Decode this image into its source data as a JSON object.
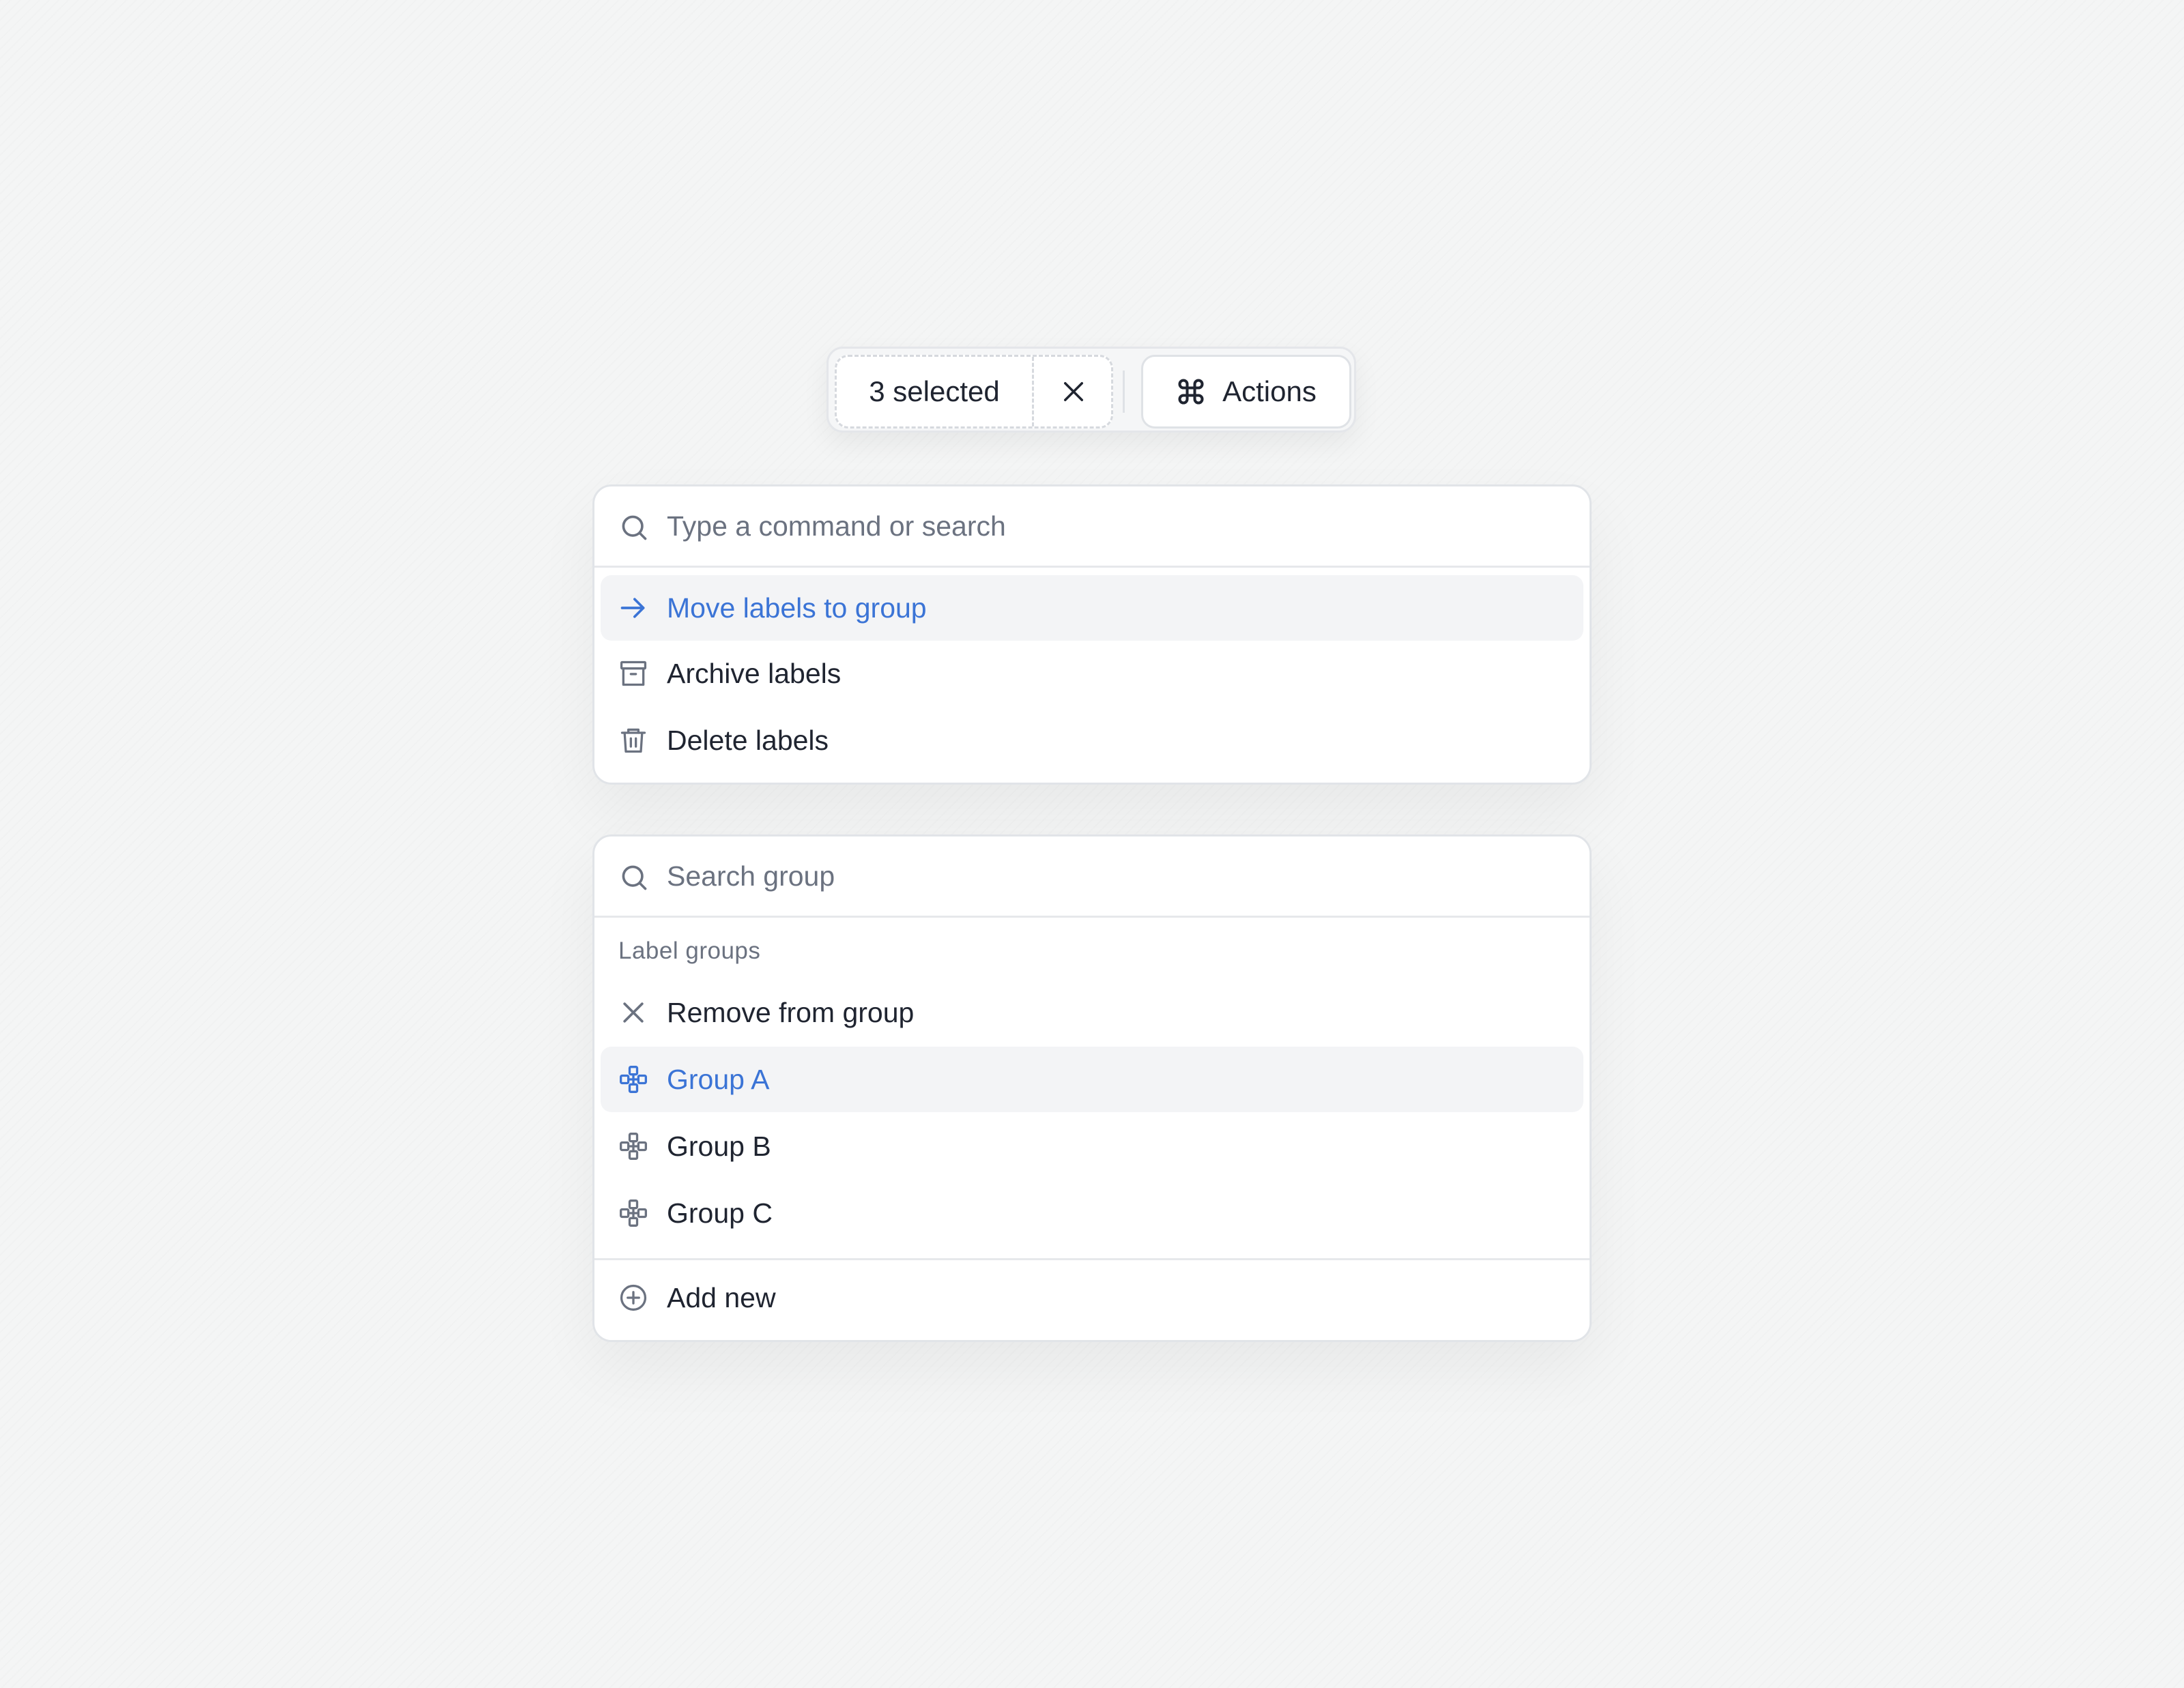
{
  "colors": {
    "accent": "#3b74d6",
    "icon_gray": "#6b7280",
    "highlight_bg": "#f3f4f6"
  },
  "toolbar": {
    "selected_label": "3 selected",
    "clear_icon": "close-icon",
    "actions_icon": "command-icon",
    "actions_label": "Actions"
  },
  "command_menu": {
    "search_icon": "search-icon",
    "search_placeholder": "Type a command or search",
    "items": [
      {
        "icon": "arrow-right-icon",
        "label": "Move labels to group",
        "active": true
      },
      {
        "icon": "archive-icon",
        "label": "Archive labels",
        "active": false
      },
      {
        "icon": "trash-icon",
        "label": "Delete labels",
        "active": false
      }
    ]
  },
  "group_menu": {
    "search_icon": "search-icon",
    "search_placeholder": "Search group",
    "section_label": "Label groups",
    "items": [
      {
        "icon": "close-icon",
        "label": "Remove from group",
        "active": false
      },
      {
        "icon": "group-icon",
        "label": "Group A",
        "active": true
      },
      {
        "icon": "group-icon",
        "label": "Group B",
        "active": false
      },
      {
        "icon": "group-icon",
        "label": "Group C",
        "active": false
      }
    ],
    "footer": {
      "icon": "plus-circle-icon",
      "label": "Add new"
    }
  }
}
